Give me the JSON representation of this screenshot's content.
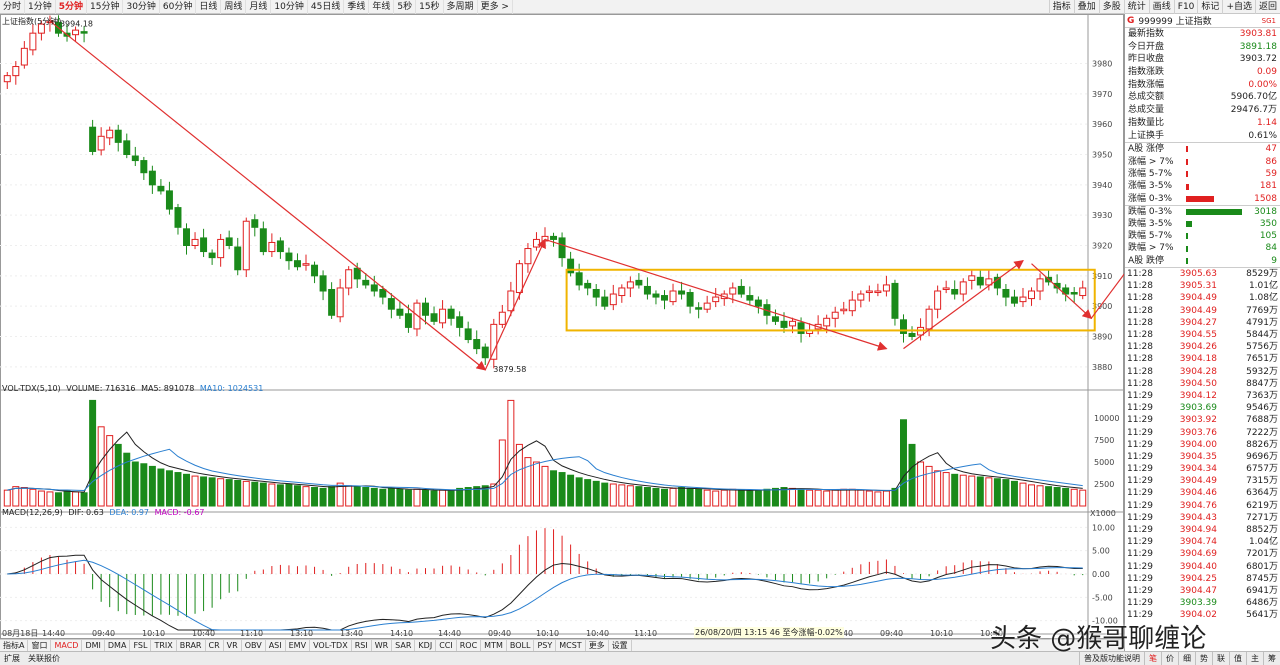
{
  "toolbar": {
    "periods": [
      "分时",
      "1分钟",
      "5分钟",
      "15分钟",
      "30分钟",
      "60分钟",
      "日线",
      "周线",
      "月线",
      "10分钟",
      "45日线",
      "季线",
      "年线",
      "5秒",
      "15秒",
      "多周期",
      "更多 >"
    ],
    "active_period": "5分钟",
    "right": [
      "指标",
      "叠加",
      "多股",
      "统计",
      "画线",
      "F10",
      "标记",
      "+自选",
      "返回"
    ]
  },
  "main_panel": {
    "title": "上证指数(5分钟)",
    "high_label": "3994.18",
    "low_label": "3879.58",
    "y_ticks": [
      "3980",
      "3970",
      "3960",
      "3950",
      "3940",
      "3930",
      "3920",
      "3910",
      "3900",
      "3890",
      "3880"
    ]
  },
  "volume_panel": {
    "label": "VOL-TDX(5,10)",
    "volume": "VOLUME: 716316",
    "ma5": "MA5: 891078",
    "ma10": "MA10: 1024531",
    "y_ticks": [
      "10000",
      "7500",
      "5000",
      "2500"
    ],
    "unit": "X1000"
  },
  "macd_panel": {
    "label": "MACD(12,26,9)",
    "dif": "DIF: 0.63",
    "dea": "DEA: 0.97",
    "macd": "MACD: -0.67",
    "y_ticks": [
      "10.00",
      "5.00",
      "0.00",
      "-5.00",
      "-10.00"
    ]
  },
  "x_axis": [
    "08月18日",
    "14:40",
    "09:40",
    "10:10",
    "10:40",
    "11:10",
    "13:10",
    "13:40",
    "14:10",
    "14:40",
    "09:40",
    "10:10",
    "10:40",
    "11:10",
    "14:40",
    "09:40",
    "10:10",
    "10:40"
  ],
  "tooltip": "26/08/20/四 13:15 46 至今涨幅-0.02%",
  "indicator_tabs": [
    "指标A",
    "窗口",
    "MACD",
    "DMI",
    "DMA",
    "FSL",
    "TRIX",
    "BRAR",
    "CR",
    "VR",
    "OBV",
    "ASI",
    "EMV",
    "VOL-TDX",
    "RSI",
    "WR",
    "SAR",
    "KDJ",
    "CCI",
    "ROC",
    "MTM",
    "BOLL",
    "PSY",
    "MCST",
    "更多",
    "设置"
  ],
  "active_tab": "MACD",
  "status": {
    "left": [
      "扩展",
      "关联报价"
    ],
    "right_label": "普及版功能说明",
    "right_buttons": [
      "笔",
      "价",
      "细",
      "势",
      "联",
      "值",
      "主",
      "筹"
    ]
  },
  "watermark": "头条 @猴哥聊缠论",
  "info": {
    "g": "G",
    "code": "999999 上证指数",
    "tag": "SG1",
    "stats": [
      {
        "label": "最新指数",
        "value": "3903.81",
        "color": "#e02020"
      },
      {
        "label": "今日开盘",
        "value": "3891.18",
        "color": "#1a8a1a"
      },
      {
        "label": "昨日收盘",
        "value": "3903.72",
        "color": "#222222"
      },
      {
        "label": "指数涨跌",
        "value": "0.09",
        "color": "#e02020"
      },
      {
        "label": "指数涨幅",
        "value": "0.00%",
        "color": "#e02020"
      },
      {
        "label": "总成交额",
        "value": "5906.70亿",
        "color": "#222222"
      },
      {
        "label": "总成交量",
        "value": "29476.7万",
        "color": "#222222"
      },
      {
        "label": "指数量比",
        "value": "1.14",
        "color": "#e02020"
      },
      {
        "label": "上证换手",
        "value": "0.61%",
        "color": "#222222"
      }
    ],
    "breadth": [
      {
        "label": "A股 涨停",
        "value": "47",
        "frac": 0.0,
        "color": "#e02020"
      },
      {
        "label": "涨幅 > 7%",
        "value": "86",
        "frac": 0.01,
        "color": "#e02020"
      },
      {
        "label": "涨幅 5-7%",
        "value": "59",
        "frac": 0.01,
        "color": "#e02020"
      },
      {
        "label": "涨幅 3-5%",
        "value": "181",
        "frac": 0.05,
        "color": "#e02020"
      },
      {
        "label": "涨幅 0-3%",
        "value": "1508",
        "frac": 0.5,
        "color": "#e02020"
      },
      {
        "label": "跌幅 0-3%",
        "value": "3018",
        "frac": 1.0,
        "color": "#1a8a1a"
      },
      {
        "label": "跌幅 3-5%",
        "value": "350",
        "frac": 0.11,
        "color": "#1a8a1a"
      },
      {
        "label": "跌幅 5-7%",
        "value": "105",
        "frac": 0.03,
        "color": "#1a8a1a"
      },
      {
        "label": "跌幅 > 7%",
        "value": "84",
        "frac": 0.02,
        "color": "#1a8a1a"
      },
      {
        "label": "A股 跌停",
        "value": "9",
        "frac": 0.0,
        "color": "#1a8a1a"
      }
    ],
    "ticks": [
      {
        "t": "11:28",
        "p": "3905.63",
        "v": "8529万",
        "c": "#e02020"
      },
      {
        "t": "11:28",
        "p": "3905.31",
        "v": "1.01亿",
        "c": "#e02020"
      },
      {
        "t": "11:28",
        "p": "3904.49",
        "v": "1.08亿",
        "c": "#e02020"
      },
      {
        "t": "11:28",
        "p": "3904.49",
        "v": "7769万",
        "c": "#e02020"
      },
      {
        "t": "11:28",
        "p": "3904.27",
        "v": "4791万",
        "c": "#e02020"
      },
      {
        "t": "11:28",
        "p": "3904.55",
        "v": "5844万",
        "c": "#e02020"
      },
      {
        "t": "11:28",
        "p": "3904.26",
        "v": "5756万",
        "c": "#e02020"
      },
      {
        "t": "11:28",
        "p": "3904.18",
        "v": "7651万",
        "c": "#e02020"
      },
      {
        "t": "11:28",
        "p": "3904.28",
        "v": "5932万",
        "c": "#e02020"
      },
      {
        "t": "11:28",
        "p": "3904.50",
        "v": "8847万",
        "c": "#e02020"
      },
      {
        "t": "11:29",
        "p": "3904.12",
        "v": "7363万",
        "c": "#e02020"
      },
      {
        "t": "11:29",
        "p": "3903.69",
        "v": "9546万",
        "c": "#1a8a1a"
      },
      {
        "t": "11:29",
        "p": "3903.92",
        "v": "7688万",
        "c": "#e02020"
      },
      {
        "t": "11:29",
        "p": "3903.76",
        "v": "7222万",
        "c": "#e02020"
      },
      {
        "t": "11:29",
        "p": "3904.00",
        "v": "8826万",
        "c": "#e02020"
      },
      {
        "t": "11:29",
        "p": "3904.35",
        "v": "9696万",
        "c": "#e02020"
      },
      {
        "t": "11:29",
        "p": "3904.34",
        "v": "6757万",
        "c": "#e02020"
      },
      {
        "t": "11:29",
        "p": "3904.49",
        "v": "7315万",
        "c": "#e02020"
      },
      {
        "t": "11:29",
        "p": "3904.46",
        "v": "6364万",
        "c": "#e02020"
      },
      {
        "t": "11:29",
        "p": "3904.76",
        "v": "6219万",
        "c": "#e02020"
      },
      {
        "t": "11:29",
        "p": "3904.43",
        "v": "7271万",
        "c": "#e02020"
      },
      {
        "t": "11:29",
        "p": "3904.94",
        "v": "8852万",
        "c": "#e02020"
      },
      {
        "t": "11:29",
        "p": "3904.74",
        "v": "1.04亿",
        "c": "#e02020"
      },
      {
        "t": "11:29",
        "p": "3904.69",
        "v": "7201万",
        "c": "#e02020"
      },
      {
        "t": "11:29",
        "p": "3904.40",
        "v": "6801万",
        "c": "#e02020"
      },
      {
        "t": "11:29",
        "p": "3904.25",
        "v": "8745万",
        "c": "#e02020"
      },
      {
        "t": "11:29",
        "p": "3904.47",
        "v": "6941万",
        "c": "#e02020"
      },
      {
        "t": "11:29",
        "p": "3903.39",
        "v": "6486万",
        "c": "#1a8a1a"
      },
      {
        "t": "11:29",
        "p": "3904.02",
        "v": "5641万",
        "c": "#e02020"
      }
    ]
  },
  "chart_data": {
    "type": "candlestick",
    "title": "上证指数(5分钟)",
    "ylim": [
      3875,
      3995
    ],
    "colors": {
      "up": "#e02020",
      "down": "#1a8a1a",
      "ma5": "#222222",
      "ma10": "#2a7fd0",
      "box": "#f0b400",
      "trend": "#e03030"
    },
    "closes": [
      3976,
      3979,
      3985,
      3990,
      3993,
      3994,
      3990,
      3989,
      3991,
      3990,
      3951,
      3956,
      3958,
      3954,
      3950,
      3948,
      3944,
      3940,
      3938,
      3932,
      3926,
      3920,
      3922,
      3918,
      3916,
      3922,
      3920,
      3912,
      3928,
      3926,
      3918,
      3921,
      3918,
      3915,
      3913,
      3914,
      3910,
      3905,
      3897,
      3906,
      3912,
      3909,
      3907,
      3905,
      3903,
      3899,
      3897,
      3893,
      3901,
      3897,
      3895,
      3899,
      3896,
      3893,
      3889,
      3886,
      3883,
      3894,
      3898,
      3905,
      3914,
      3919,
      3922,
      3923,
      3922,
      3916,
      3911,
      3907,
      3906,
      3903,
      3900,
      3904,
      3906,
      3908,
      3907,
      3904,
      3903,
      3902,
      3905,
      3904,
      3900,
      3899,
      3901,
      3903,
      3904,
      3906,
      3904,
      3902,
      3900,
      3897,
      3895,
      3893,
      3895,
      3891,
      3892,
      3894,
      3896,
      3898,
      3899,
      3902,
      3904,
      3905,
      3905,
      3907,
      3896,
      3891,
      3890,
      3893,
      3899,
      3905,
      3906,
      3904,
      3908,
      3910,
      3907,
      3909,
      3906,
      3903,
      3901,
      3903,
      3905,
      3909,
      3908,
      3906,
      3904,
      3904,
      3906
    ],
    "volume_ylim": [
      0,
      12500
    ],
    "volumes": [
      1800,
      2200,
      2100,
      1900,
      1700,
      1600,
      1500,
      1700,
      1600,
      1500,
      12000,
      9000,
      8000,
      7000,
      6000,
      5000,
      4800,
      4500,
      4200,
      4000,
      3800,
      3600,
      3400,
      3300,
      3200,
      3100,
      3000,
      2900,
      2800,
      2700,
      2600,
      2500,
      2400,
      2500,
      2300,
      2200,
      2100,
      2000,
      2200,
      2600,
      2300,
      2200,
      2100,
      2000,
      1900,
      2000,
      1900,
      1800,
      1900,
      1800,
      1700,
      1800,
      1700,
      2000,
      2100,
      2200,
      2300,
      2500,
      7500,
      12000,
      7000,
      5500,
      5000,
      4500,
      4000,
      3800,
      3500,
      3200,
      3000,
      2800,
      2600,
      2500,
      2400,
      2300,
      2200,
      2100,
      2000,
      1900,
      2000,
      2100,
      2000,
      1900,
      1800,
      1700,
      1800,
      1900,
      1800,
      1700,
      1800,
      1900,
      2000,
      2100,
      2000,
      1900,
      1800,
      1800,
      1700,
      1800,
      1900,
      1900,
      1800,
      1700,
      1600,
      1700,
      2000,
      9800,
      7000,
      5000,
      4500,
      4000,
      3800,
      3600,
      3500,
      3400,
      3300,
      3200,
      3100,
      3000,
      2800,
      2600,
      2400,
      2300,
      2200,
      2100,
      2000,
      1900,
      1800
    ],
    "macd_ylim": [
      -12,
      12
    ]
  }
}
